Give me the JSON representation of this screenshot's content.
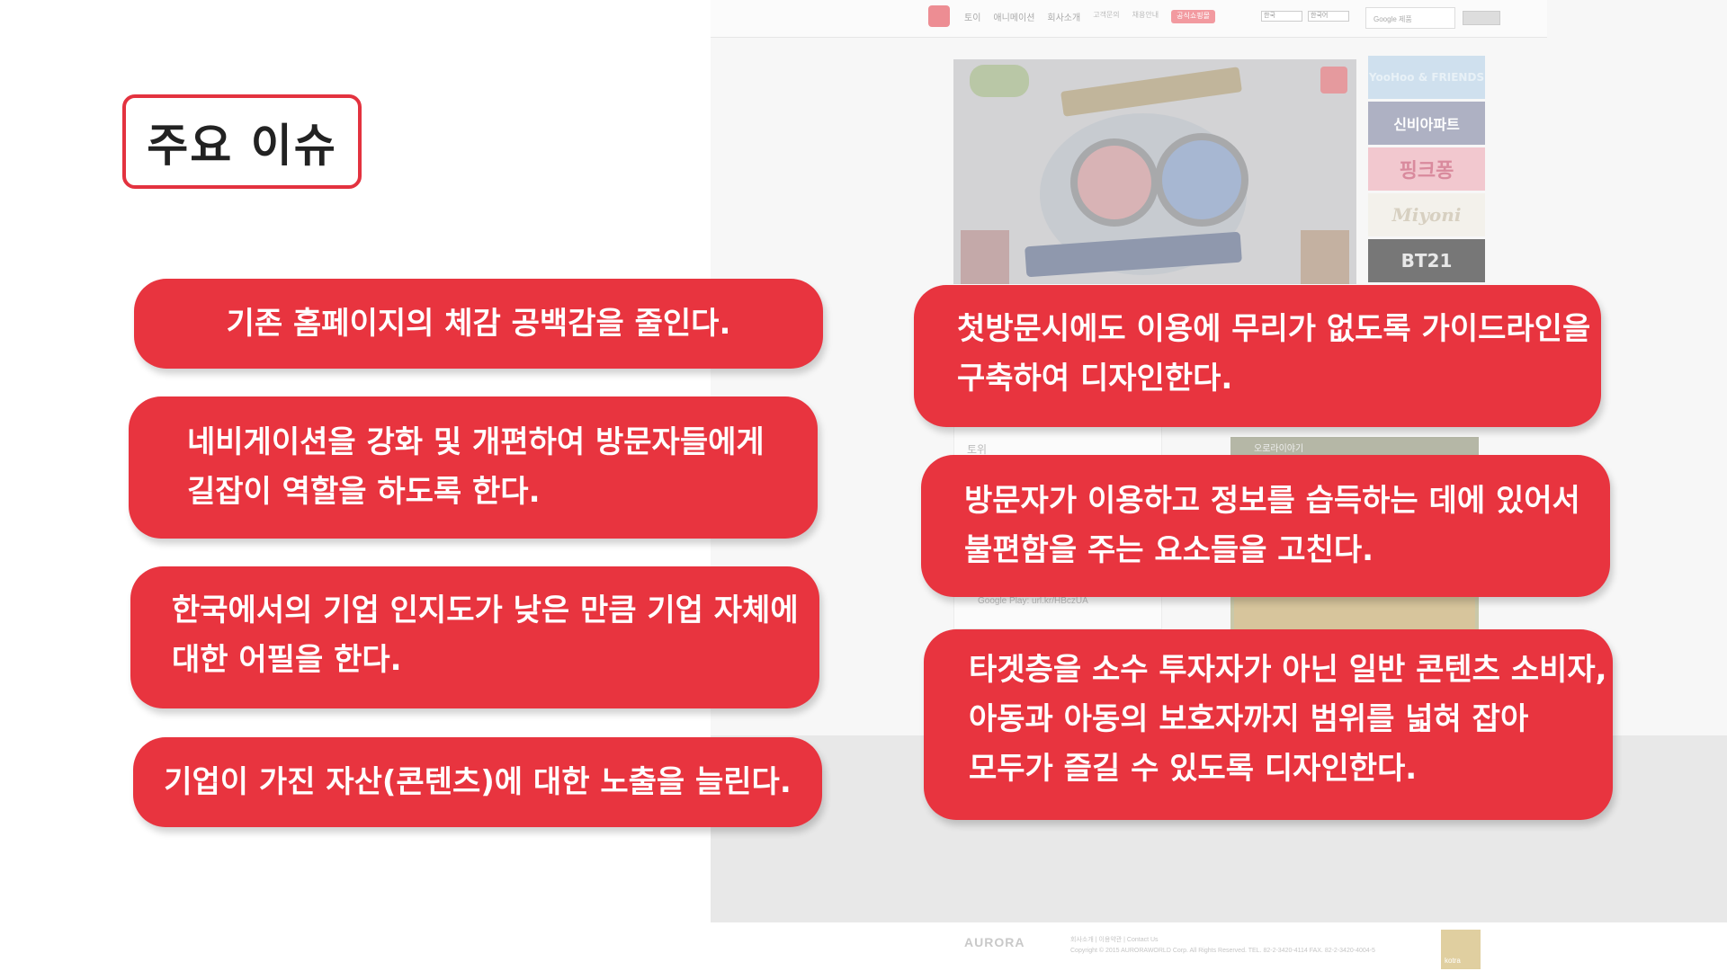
{
  "slide": {
    "title": "주요 이슈",
    "left_issues": [
      {
        "lines": [
          "기존 홈페이지의 체감 공백감을 줄인다."
        ]
      },
      {
        "lines": [
          "네비게이션을 강화 및 개편하여 방문자들에게",
          "길잡이 역할을 하도록 한다."
        ]
      },
      {
        "lines": [
          "한국에서의 기업 인지도가 낮은 만큼 기업 자체에",
          "대한 어필을 한다."
        ]
      },
      {
        "lines": [
          "기업이 가진 자산(콘텐츠)에 대한 노출을 늘린다."
        ]
      }
    ],
    "right_issues": [
      {
        "lines": [
          "첫방문시에도 이용에 무리가 없도록 가이드라인을",
          "구축하여 디자인한다."
        ]
      },
      {
        "lines": [
          "방문자가 이용하고 정보를 습득하는 데에 있어서",
          "불편함을 주는 요소들을 고친다."
        ]
      },
      {
        "lines": [
          "타겟층을 소수 투자자가 아닌 일반 콘텐츠 소비자,",
          "아동과 아동의 보호자까지 범위를 넓혀 잡아",
          "모두가 즐길 수 있도록 디자인한다."
        ]
      }
    ]
  },
  "background_site": {
    "nav": [
      "토이",
      "애니메이션",
      "회사소개"
    ],
    "nav_sub": [
      "고객문의",
      "채용안내"
    ],
    "nav_pill": "공식쇼핑몰",
    "lang_select_1": "한국",
    "lang_select_2": "한국어",
    "search_placeholder": "Google 제품",
    "brands": [
      "YooHoo & FRIENDS",
      "신비아파트",
      "핑크퐁",
      "Miyoni",
      "BT21"
    ],
    "panel_title": "토위",
    "panel_link": "Google Play: url.kr/HBczUA",
    "card_caption": "오로라이야기",
    "footer_logo": "AURORA",
    "footer_links": "회사소개 | 이용약관 | Contact Us",
    "copyright": "Copyright © 2015 AURORAWORLD Corp. All Rights Reserved. TEL. 82-2-3420-4114 FAX. 82-2-3420-4004-5",
    "partner_logo": "kotra"
  },
  "colors": {
    "accent_red": "#e8343f",
    "title_border": "#e3323f"
  }
}
